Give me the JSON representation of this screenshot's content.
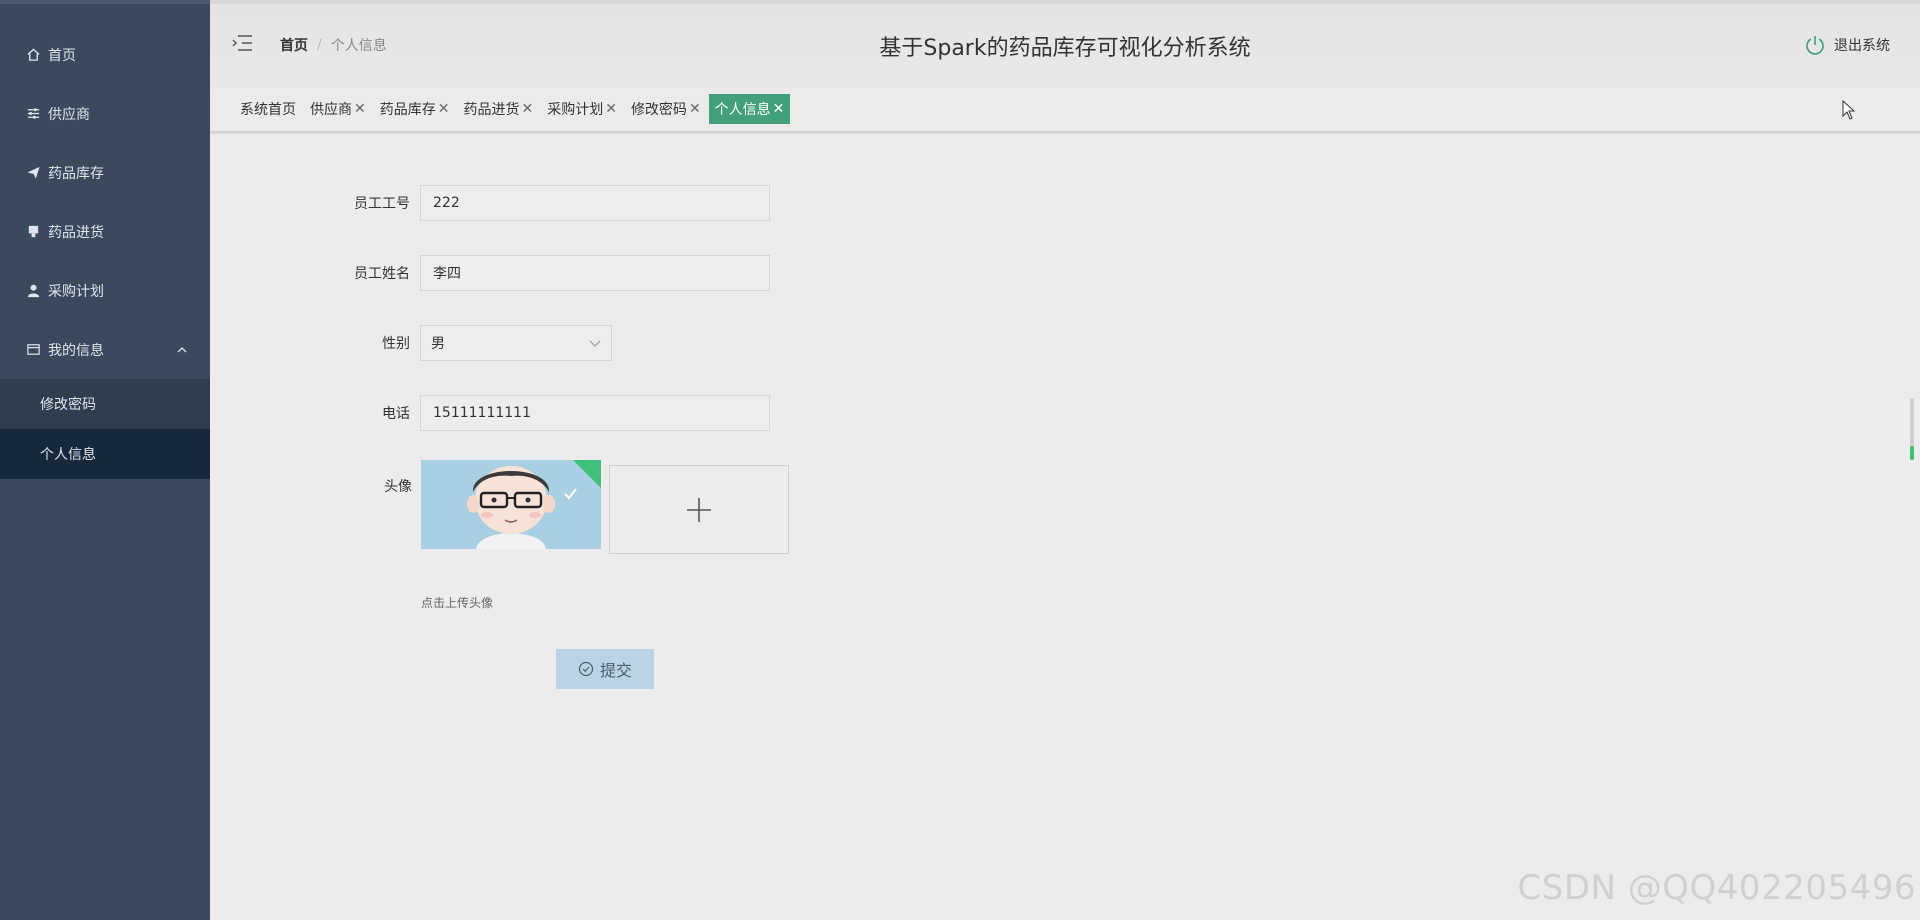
{
  "sidebar": {
    "items": [
      {
        "label": "首页",
        "icon": "home-icon"
      },
      {
        "label": "供应商",
        "icon": "sliders-icon"
      },
      {
        "label": "药品库存",
        "icon": "send-icon"
      },
      {
        "label": "药品进货",
        "icon": "bookmark-icon"
      },
      {
        "label": "采购计划",
        "icon": "user-icon"
      },
      {
        "label": "我的信息",
        "icon": "card-icon"
      }
    ],
    "sub_items": [
      {
        "label": "修改密码"
      },
      {
        "label": "个人信息"
      }
    ]
  },
  "header": {
    "breadcrumb_home": "首页",
    "breadcrumb_sep": "/",
    "breadcrumb_current": "个人信息",
    "title": "基于Spark的药品库存可视化分析系统",
    "logout_label": "退出系统"
  },
  "tabs": [
    {
      "label": "系统首页",
      "closable": false
    },
    {
      "label": "供应商",
      "closable": true
    },
    {
      "label": "药品库存",
      "closable": true
    },
    {
      "label": "药品进货",
      "closable": true
    },
    {
      "label": "采购计划",
      "closable": true
    },
    {
      "label": "修改密码",
      "closable": true
    },
    {
      "label": "个人信息",
      "closable": true,
      "active": true
    }
  ],
  "close_glyph": "✕",
  "form": {
    "emp_no_label": "员工工号",
    "emp_no_value": "222",
    "emp_name_label": "员工姓名",
    "emp_name_value": "李四",
    "gender_label": "性别",
    "gender_value": "男",
    "phone_label": "电话",
    "phone_value": "15111111111",
    "avatar_label": "头像",
    "upload_hint": "点击上传头像",
    "submit_label": "提交"
  },
  "watermark": "CSDN @QQ402205496",
  "colors": {
    "sidebar_bg": "#3a4a5c",
    "active_tab": "#42a07b",
    "submit_bg": "#bcd3e6"
  }
}
